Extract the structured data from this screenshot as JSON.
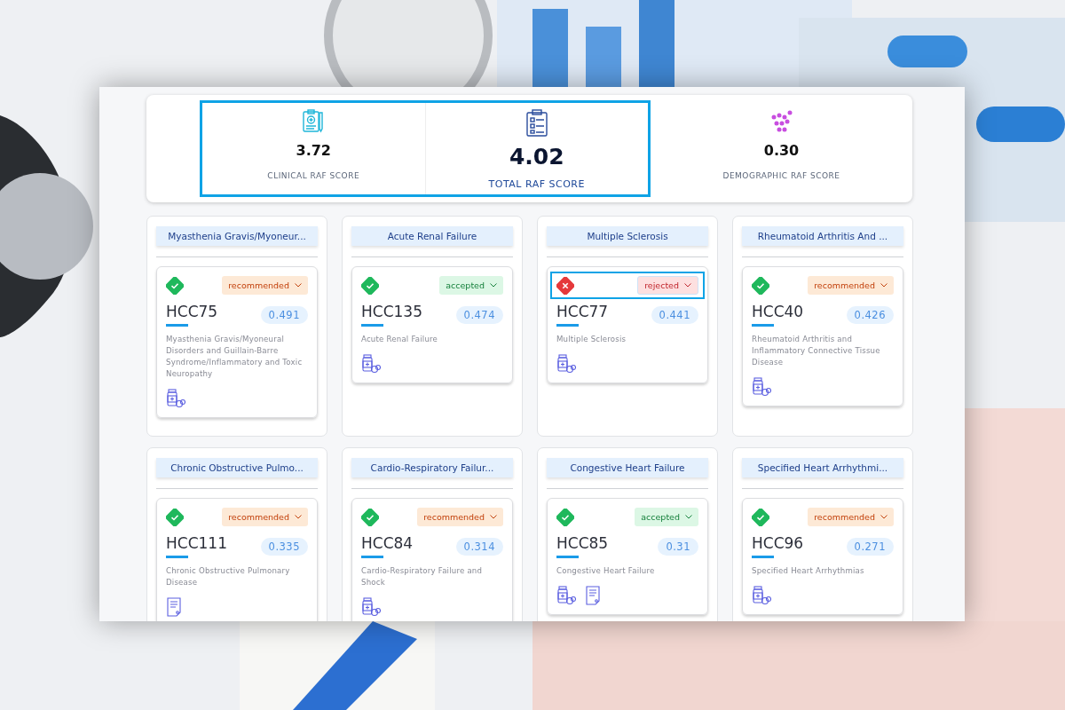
{
  "summary": {
    "items": [
      {
        "kind": "clinical",
        "value": "3.72",
        "label": "CLINICAL RAF SCORE",
        "highlighted": true
      },
      {
        "kind": "total",
        "value": "4.02",
        "label": "TOTAL RAF SCORE",
        "highlighted": true
      },
      {
        "kind": "demographic",
        "value": "0.30",
        "label": "DEMOGRAPHIC RAF SCORE",
        "highlighted": false
      }
    ]
  },
  "groups": [
    {
      "title": "Myasthenia Gravis/Myoneur...",
      "code": "HCC75",
      "score": "0.491",
      "valid": true,
      "status": {
        "kind": "recommended",
        "label": "recommended"
      },
      "highlighted": false,
      "description": "Myasthenia Gravis/Myoneural Disorders and Guillain-Barre Syndrome/Inflammatory and Toxic Neuropathy",
      "icons": [
        {
          "kind": "medication"
        }
      ]
    },
    {
      "title": "Acute Renal Failure",
      "code": "HCC135",
      "score": "0.474",
      "valid": true,
      "status": {
        "kind": "accepted",
        "label": "accepted"
      },
      "highlighted": false,
      "description": "Acute Renal Failure",
      "icons": [
        {
          "kind": "medication"
        }
      ]
    },
    {
      "title": "Multiple Sclerosis",
      "code": "HCC77",
      "score": "0.441",
      "valid": false,
      "status": {
        "kind": "rejected",
        "label": "rejected"
      },
      "highlighted": true,
      "description": "Multiple Sclerosis",
      "icons": [
        {
          "kind": "medication"
        }
      ]
    },
    {
      "title": "Rheumatoid Arthritis And ...",
      "code": "HCC40",
      "score": "0.426",
      "valid": true,
      "status": {
        "kind": "recommended",
        "label": "recommended"
      },
      "highlighted": false,
      "description": "Rheumatoid Arthritis and Inflammatory Connective Tissue Disease",
      "icons": [
        {
          "kind": "medication"
        }
      ]
    },
    {
      "title": "Chronic Obstructive Pulmo...",
      "code": "HCC111",
      "score": "0.335",
      "valid": true,
      "status": {
        "kind": "recommended",
        "label": "recommended"
      },
      "highlighted": false,
      "description": "Chronic Obstructive Pulmonary Disease",
      "icons": [
        {
          "kind": "document"
        }
      ]
    },
    {
      "title": "Cardio-Respiratory Failur...",
      "code": "HCC84",
      "score": "0.314",
      "valid": true,
      "status": {
        "kind": "recommended",
        "label": "recommended"
      },
      "highlighted": false,
      "description": "Cardio-Respiratory Failure and Shock",
      "icons": [
        {
          "kind": "medication"
        }
      ]
    },
    {
      "title": "Congestive Heart Failure",
      "code": "HCC85",
      "score": "0.31",
      "valid": true,
      "status": {
        "kind": "accepted",
        "label": "accepted"
      },
      "highlighted": false,
      "description": "Congestive Heart Failure",
      "icons": [
        {
          "kind": "medication"
        },
        {
          "kind": "document"
        }
      ]
    },
    {
      "title": "Specified Heart Arrhythmi...",
      "code": "HCC96",
      "score": "0.271",
      "valid": true,
      "status": {
        "kind": "recommended",
        "label": "recommended"
      },
      "highlighted": false,
      "description": "Specified Heart Arrhythmias",
      "icons": [
        {
          "kind": "medication"
        }
      ]
    }
  ]
}
